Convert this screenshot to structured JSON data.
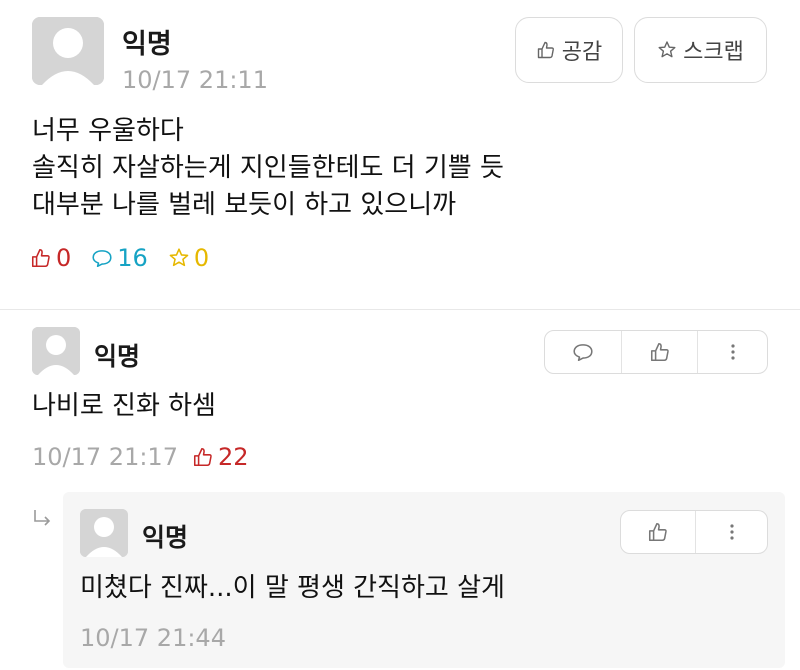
{
  "post": {
    "author": "익명",
    "timestamp": "10/17 21:11",
    "like_button": "공감",
    "scrap_button": "스크랩",
    "lines": [
      "너무 우울하다",
      "솔직히 자살하는게 지인들한테도 더 기쁠 듯",
      "대부분 나를 벌레 보듯이 하고 있으니까"
    ],
    "likes": "0",
    "comments": "16",
    "scraps": "0"
  },
  "comment": {
    "author": "익명",
    "text": "나비로 진화 하셈",
    "timestamp": "10/17 21:17",
    "likes": "22"
  },
  "reply": {
    "author": "익명",
    "text": "미쳤다 진짜...이 말 평생 간직하고 살게",
    "timestamp": "10/17 21:44"
  },
  "colors": {
    "like_red": "#c62828",
    "comment_cyan": "#16a3c4",
    "scrap_gold": "#e6b800",
    "meta_gray": "#a8a8a8"
  }
}
